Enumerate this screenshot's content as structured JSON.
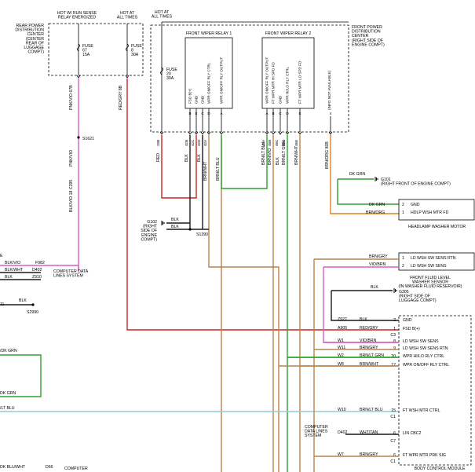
{
  "colors": {
    "red": "#c8241f",
    "pink_violet": "#d85fc0",
    "black": "#1a1a1a",
    "violet": "#b64dc0",
    "green": "#2fa02f",
    "brown": "#b9844a",
    "light_blue": "#8fd0d0",
    "orange": "#e08020",
    "gray": "#808080"
  },
  "rear_pdc": {
    "header_left": "HOT W/ RUN SENSE\nRELAY ENERGIZED",
    "header_right": "HOT AT\nALL TIMES",
    "name": "REAR POWER\nDISTRIBUTION\nCENTER\n(CENTER\nREAR OF\nLUGGAGE\nCOMPT)",
    "fuse_a": "FUSE\n67\n15A",
    "fuse_b": "FUSE\n8\n30A"
  },
  "front_pdc": {
    "header": "HOT AT\nALL TIMES",
    "name": "FRONT POWER\nDISTRIBUTION\nCENTER\n(RIGHT SIDE OF\nENGINE COMPT)",
    "fuse": "FUSE\n20\n30A",
    "relay1_title": "FRONT WIPER RELAY 1",
    "relay2_title": "FRONT WIPER RELAY 2",
    "relay1_pins": [
      "FSD B(+)",
      "GND",
      "GND",
      "WPR ON/OFF RLY CTRL",
      "WPR ON/OFF RLY OUTPUT"
    ],
    "relay2_pins": [
      "WPR ON/OFF RLY OUTPUT",
      "FT WPR MTR HI SPD FD",
      "GND",
      "WPR HI/LO RLY CTRL",
      "FT WPR MTR LO SPD FD"
    ],
    "relay1_cavities": [
      "B",
      "E",
      "C",
      "D",
      "A"
    ],
    "relay2_cavities": [
      "A",
      "B",
      "C",
      "D",
      "E"
    ],
    "info_label": "(INFO NOT AVAILABLE)",
    "info_cavity": "4"
  },
  "wires": {
    "left_top": "PNK/VIO 67B",
    "red_gry": "RED/GRY 8B",
    "pnk_vio_2": "PNK/VIO",
    "splice_s1621": "S1621",
    "blk_vio_c295": "BLK/VIO 18 C295",
    "red_20b": "RED 20B",
    "w_red": "RED",
    "w_blk_1": "BLK",
    "w_blk_2": "BLK",
    "w_brnwht": "BRN/WHT",
    "w_brnltblu": "BRN/LT BLU",
    "w_brnltblu2": "BRN/LT BLU",
    "w_brnvio": "BRN/VIO",
    "w_blk3": "BLK",
    "w_brnltgrn": "BRN/LT GRN",
    "w_brnwht2": "BRN/WHT",
    "brn_org": "BRN/ORG 80B",
    "circuit_nums_r1": [
      "20B",
      "42B",
      "42C",
      "42D",
      "42A"
    ],
    "circuit_nums_r2": [
      "46A",
      "46B",
      "46C",
      "46D",
      "46E"
    ]
  },
  "ground_g102": {
    "label": "G102\n(RIGHT\nSIDE OF\nENGINE\nCOMPT)",
    "wire1": "BLK",
    "wire2": "BLK",
    "splice": "S1390"
  },
  "ground_g101": {
    "wire": "DK GRN",
    "label": "G101\n(RIGHT FRONT OF ENGINE COMPT)"
  },
  "headlamp_motor": {
    "row1_wire": "DK GRN",
    "row1_pin": "2",
    "row1_func": "GND",
    "row2_wire": "BRN/ORG",
    "row2_pin": "1",
    "row2_func": "HDLP WSH MTR FD",
    "name": "HEADLAMP WASHER MOTOR"
  },
  "left_panel": {
    "row1_code": "F982",
    "row1_wire": "BLK/VIO",
    "row2_code": "D402",
    "row2_wire": "BLK/WHT",
    "row3_code": "Z910",
    "row3_wire": "BLK",
    "cds_label": "COMPUTER DATA\nLINES SYSTEM",
    "row4_wire": "BLK",
    "splice": "S2990",
    "left_e": "E",
    "left_11": "11",
    "dkgrn1": "/DK GRN",
    "dkgrn2": "DK GRN",
    "ltblu": "/LT BLU",
    "dkbluwht": "DK BLU/WHT",
    "d66": "D66",
    "computer": "COMPUTER"
  },
  "fluid_sensor": {
    "row1_wire": "BRN/GRY",
    "row1_pin": "1",
    "row1_func": "LD WSH SW SENS RTN",
    "row2_wire": "VIO/BRN",
    "row2_pin": "2",
    "row2_func": "LD WSH SW SENS",
    "name": "FRONT FLUID LEVEL\nWASHER SENSOR\n(IN WASHER FLUID RESERVOIR)"
  },
  "ground_g305": {
    "wire": "BLK",
    "label": "G305\n(RIGHT SIDE OF\nLUGGAGE COMPT)"
  },
  "bcm": {
    "name": "BODY CONTROL MODULE",
    "rows": [
      {
        "code": "Z922",
        "wire": "BLK",
        "pin": "2",
        "func": "GND"
      },
      {
        "code": "A905",
        "wire": "RED/GRY",
        "pin": "1",
        "func": "FSD B(+)"
      },
      {
        "code": "",
        "wire": "",
        "pin": "C3",
        "func": ""
      },
      {
        "code": "W1",
        "wire": "VIO/BRN",
        "pin": "8",
        "func": "LD WSH SW SENS"
      },
      {
        "code": "W11",
        "wire": "BRN/GRY",
        "pin": "9",
        "func": "LD WSH SW SENS RTN"
      },
      {
        "code": "W2",
        "wire": "BRN/LT GRN",
        "pin": "20",
        "func": "WPR HI/LO RLY CTRL"
      },
      {
        "code": "W8",
        "wire": "BRN/WHT",
        "pin": "12",
        "func": "WPR ON/OFF RLY CTRL"
      },
      {
        "code": "W10",
        "wire": "BRN/LT BLU",
        "pin": "15",
        "func": "FT WSH MTR CTRL"
      },
      {
        "code": "",
        "wire": "",
        "pin": "C1",
        "func": ""
      },
      {
        "code": "D402",
        "wire": "WHT/TAN",
        "pin": "6",
        "func": "LIN CBC2"
      },
      {
        "code": "",
        "wire": "",
        "pin": "C7",
        "func": ""
      },
      {
        "code": "W7",
        "wire": "BRN/GRY",
        "pin": "6",
        "func": "FT WPR MTR PRK SIG"
      },
      {
        "code": "",
        "wire": "",
        "pin": "C1",
        "func": ""
      }
    ],
    "cds_label": "COMPUTER\nDATA LINES\nSYSTEM"
  }
}
